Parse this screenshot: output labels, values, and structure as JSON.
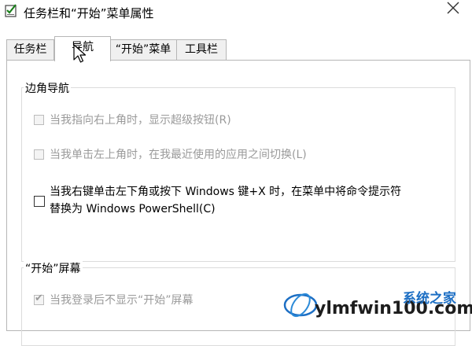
{
  "window": {
    "title": "任务栏和“开始”菜单属性",
    "icons": {
      "app": "checklist-icon",
      "close": "close-icon"
    }
  },
  "tabs": [
    {
      "label": "任务栏",
      "active": false
    },
    {
      "label": "导航",
      "active": true
    },
    {
      "label": "“开始”菜单",
      "active": false
    },
    {
      "label": "工具栏",
      "active": false
    }
  ],
  "corner_nav": {
    "title": "边角导航",
    "options": [
      {
        "label": "当我指向右上角时，显示超级按钮(R)",
        "checked": false,
        "enabled": false
      },
      {
        "label": "当我单击左上角时，在我最近使用的应用之间切换(L)",
        "checked": false,
        "enabled": false
      },
      {
        "label_line1": "当我右键单击左下角或按下 Windows 键+X 时，在菜单中将命令提示符",
        "label_line2": "替换为 Windows PowerShell(C)",
        "checked": false,
        "enabled": true
      }
    ]
  },
  "start_screen": {
    "title": "“开始”屏幕",
    "options": [
      {
        "label": "当我登录后不显示“开始”屏幕",
        "checked": true,
        "enabled": false
      }
    ]
  },
  "watermark": {
    "domain": "ylmfwin100.com",
    "brand": "系统之家"
  },
  "colors": {
    "accent": "#0078d7",
    "disabled_text": "#9a9a9a",
    "border": "#b6b6b6",
    "watermark_blue": "#1d6fc4"
  }
}
